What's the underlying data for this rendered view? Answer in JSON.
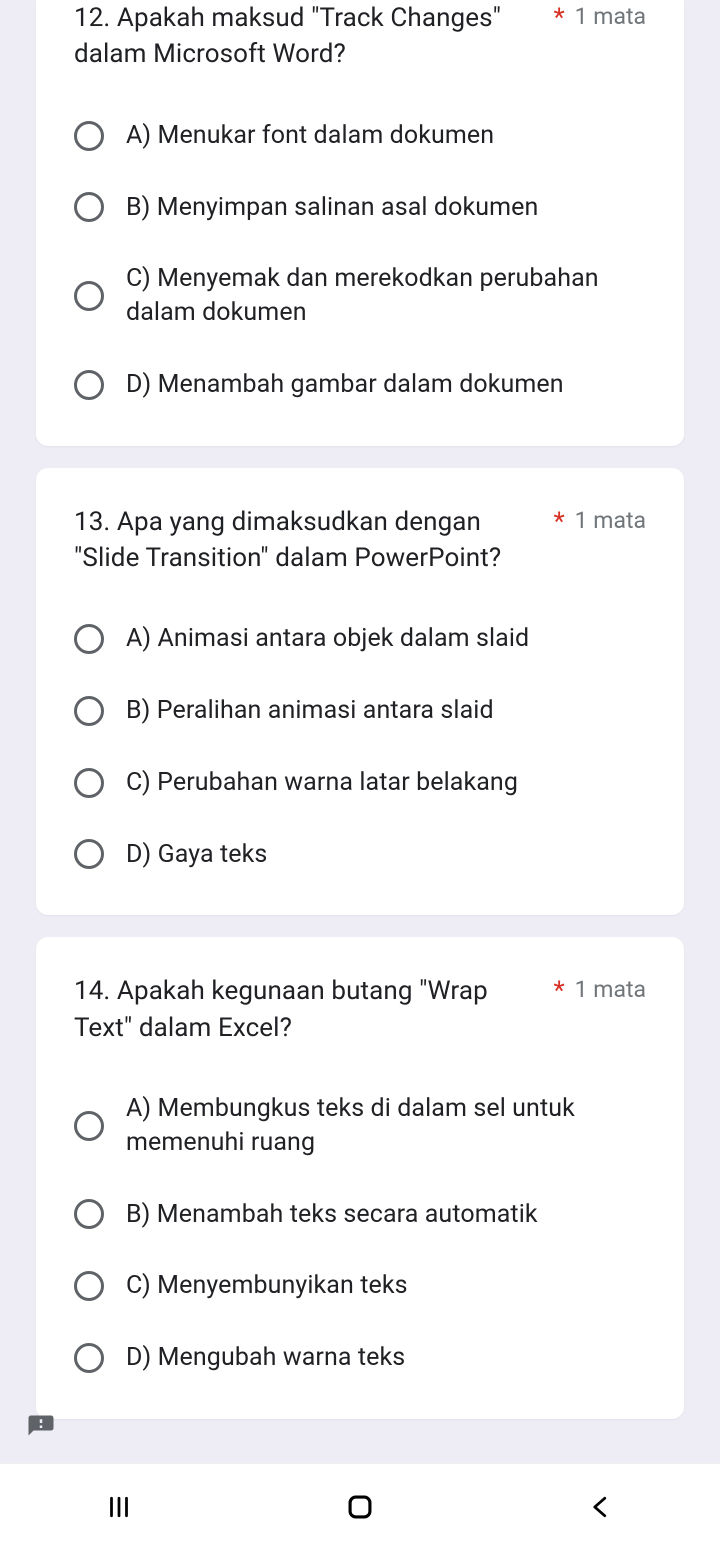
{
  "questions": [
    {
      "text": "12. Apakah maksud \"Track Changes\" dalam Microsoft Word?",
      "required_mark": "*",
      "points": "1 mata",
      "options": [
        "A) Menukar font dalam dokumen",
        "B) Menyimpan salinan asal dokumen",
        "C) Menyemak dan merekodkan perubahan dalam dokumen",
        "D) Menambah gambar dalam dokumen"
      ]
    },
    {
      "text": "13. Apa yang dimaksudkan dengan \"Slide Transition\" dalam PowerPoint?",
      "required_mark": "*",
      "points": "1 mata",
      "options": [
        "A) Animasi antara objek dalam slaid",
        "B) Peralihan animasi antara slaid",
        "C) Perubahan warna latar belakang",
        "D) Gaya teks"
      ]
    },
    {
      "text": "14. Apakah kegunaan butang \"Wrap Text\" dalam Excel?",
      "required_mark": "*",
      "points": "1 mata",
      "options": [
        "A) Membungkus teks di dalam sel untuk memenuhi ruang",
        "B) Menambah teks secara automatik",
        "C) Menyembunyikan teks",
        "D) Mengubah warna teks"
      ]
    }
  ]
}
